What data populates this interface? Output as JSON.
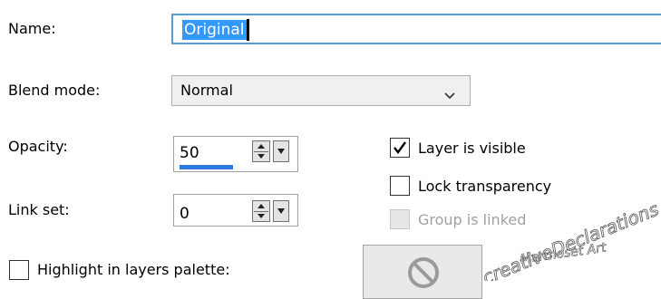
{
  "fields": {
    "name": {
      "label": "Name:",
      "value": "Original"
    },
    "blend_mode": {
      "label": "Blend mode:",
      "value": "Normal"
    },
    "opacity": {
      "label": "Opacity:",
      "value": "50",
      "level_percent": 50
    },
    "link_set": {
      "label": "Link set:",
      "value": "0"
    }
  },
  "checkboxes": {
    "layer_visible": {
      "label": "Layer is visible",
      "checked": true,
      "enabled": true
    },
    "lock_transparency": {
      "label": "Lock transparency",
      "checked": false,
      "enabled": true
    },
    "group_linked": {
      "label": "Group is linked",
      "checked": false,
      "enabled": false
    },
    "highlight": {
      "label": "Highlight in layers palette:",
      "checked": false,
      "enabled": true
    }
  },
  "icons": {
    "blend_dropdown": "chevron-down-icon",
    "spinner": "spin-arrows-icon",
    "spinner_dropdown": "triangle-down-icon",
    "checkmark": "checkmark-icon",
    "no_color": "prohibited-icon"
  },
  "watermark": {
    "line1": "creativeDeclarations",
    "line2": "Marmoset Art"
  },
  "colors": {
    "accent": "#3399ff",
    "focus_border": "#5b9bd5",
    "slider_fill": "#2e7be0",
    "disabled_text": "#a0a0a0",
    "control_bg": "#f0f0f0"
  }
}
